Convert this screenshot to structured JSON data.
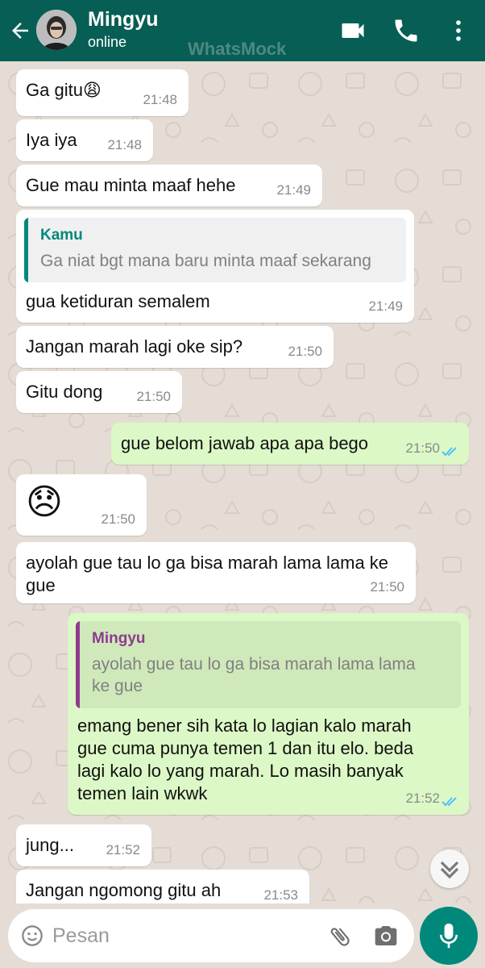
{
  "header": {
    "contact_name": "Mingyu",
    "status": "online",
    "watermark": "WhatsMock"
  },
  "messages": [
    {
      "text": "Ga gitu😩",
      "time": "21:48",
      "dir": "in"
    },
    {
      "text": "Iya iya",
      "time": "21:48",
      "dir": "in"
    },
    {
      "text": "Gue mau minta maaf hehe",
      "time": "21:49",
      "dir": "in"
    },
    {
      "quote_name": "Kamu",
      "quote_text": "Ga niat bgt mana baru minta maaf sekarang",
      "text": "gua ketiduran semalem",
      "time": "21:49",
      "dir": "in"
    },
    {
      "text": "Jangan marah lagi oke sip?",
      "time": "21:50",
      "dir": "in"
    },
    {
      "text": "Gitu dong",
      "time": "21:50",
      "dir": "in"
    },
    {
      "text": "gue belom jawab apa apa bego",
      "time": "21:50",
      "dir": "out",
      "status": "read"
    },
    {
      "text": "😞",
      "time": "21:50",
      "dir": "in"
    },
    {
      "text_lines": [
        "ayolah gue tau lo ga bisa marah lama lama ke",
        "gue"
      ],
      "time": "21:50",
      "dir": "in"
    },
    {
      "quote_name": "Mingyu",
      "quote_lines": [
        "ayolah gue tau lo ga bisa marah lama lama",
        "ke gue"
      ],
      "text_lines": [
        "emang bener sih kata lo lagian kalo marah",
        "gue cuma punya temen 1 dan itu elo. beda",
        "lagi kalo lo yang marah. Lo masih banyak",
        "temen lain wkwk"
      ],
      "time": "21:52",
      "dir": "out",
      "status": "read"
    },
    {
      "text": "jung...",
      "time": "21:52",
      "dir": "in"
    },
    {
      "text": "Jangan ngomong gitu ah",
      "time": "21:53",
      "dir": "in"
    }
  ],
  "input": {
    "placeholder": "Pesan"
  },
  "colors": {
    "header": "#075e54",
    "incoming_bubble": "#ffffff",
    "outgoing_bubble": "#dcf8c6",
    "read_ticks": "#4fc3f7",
    "quote_kamu": "#00897b",
    "quote_mingyu": "#8e3b8f",
    "mic_button": "#00897b"
  },
  "icons": {
    "header": [
      "back-arrow-icon",
      "video-call-icon",
      "phone-call-icon",
      "more-menu-icon"
    ],
    "input": [
      "emoji-icon",
      "paperclip-icon",
      "camera-icon",
      "microphone-icon"
    ],
    "scroll": "chevron-double-down-icon"
  }
}
